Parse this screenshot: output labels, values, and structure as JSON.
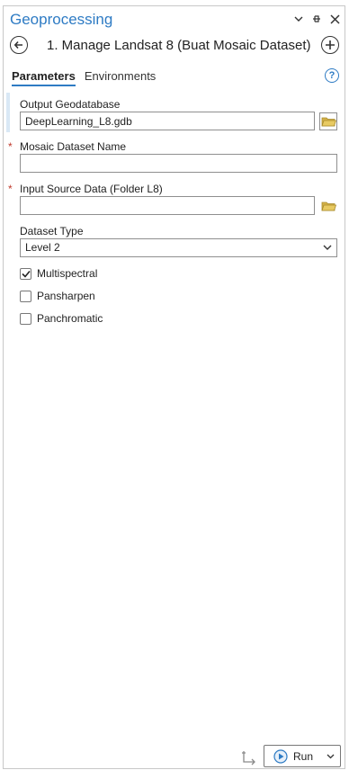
{
  "header": {
    "title": "Geoprocessing"
  },
  "tool": {
    "title": "1. Manage Landsat 8 (Buat Mosaic Dataset)"
  },
  "tabs": [
    {
      "label": "Parameters",
      "active": true
    },
    {
      "label": "Environments",
      "active": false
    }
  ],
  "params": {
    "output_gdb": {
      "label": "Output Geodatabase",
      "value": "DeepLearning_L8.gdb"
    },
    "mosaic_name": {
      "label": "Mosaic Dataset Name",
      "required": "*",
      "value": ""
    },
    "input_source": {
      "label": "Input Source Data (Folder L8)",
      "required": "*",
      "value": ""
    },
    "dataset_type": {
      "label": "Dataset Type",
      "value": "Level 2"
    },
    "checkboxes": [
      {
        "label": "Multispectral",
        "checked": true
      },
      {
        "label": "Pansharpen",
        "checked": false
      },
      {
        "label": "Panchromatic",
        "checked": false
      }
    ]
  },
  "footer": {
    "run_label": "Run"
  },
  "colors": {
    "accent": "#2e7bc4",
    "required": "#c0392b",
    "folder": "#d4b24a"
  }
}
